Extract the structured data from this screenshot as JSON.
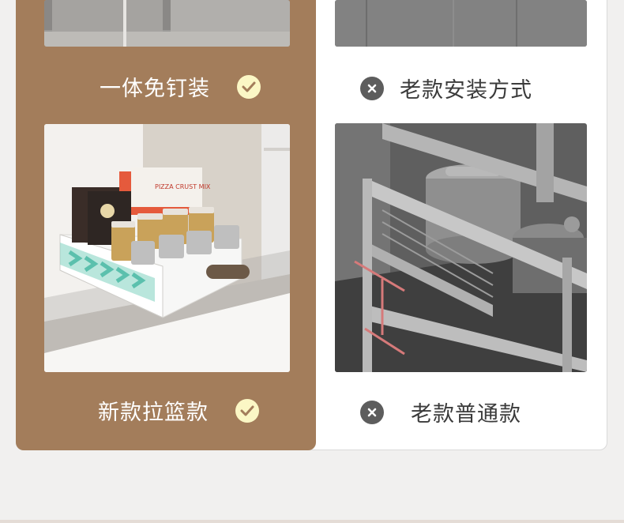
{
  "comparison": {
    "row1": {
      "new_label": "一体免钉装",
      "old_label": "老款安装方式"
    },
    "row2": {
      "new_label": "新款拉篮款",
      "old_label": "老款普通款"
    },
    "product_box_text": "PIZZA CRUST MIX"
  },
  "icons": {
    "new": "check-icon",
    "old": "x-icon"
  },
  "colors": {
    "new_panel": "#a37d5b",
    "check_bg": "#fbf7c5",
    "check_mark": "#a37d5b",
    "x_bg": "#5d5d5d"
  }
}
